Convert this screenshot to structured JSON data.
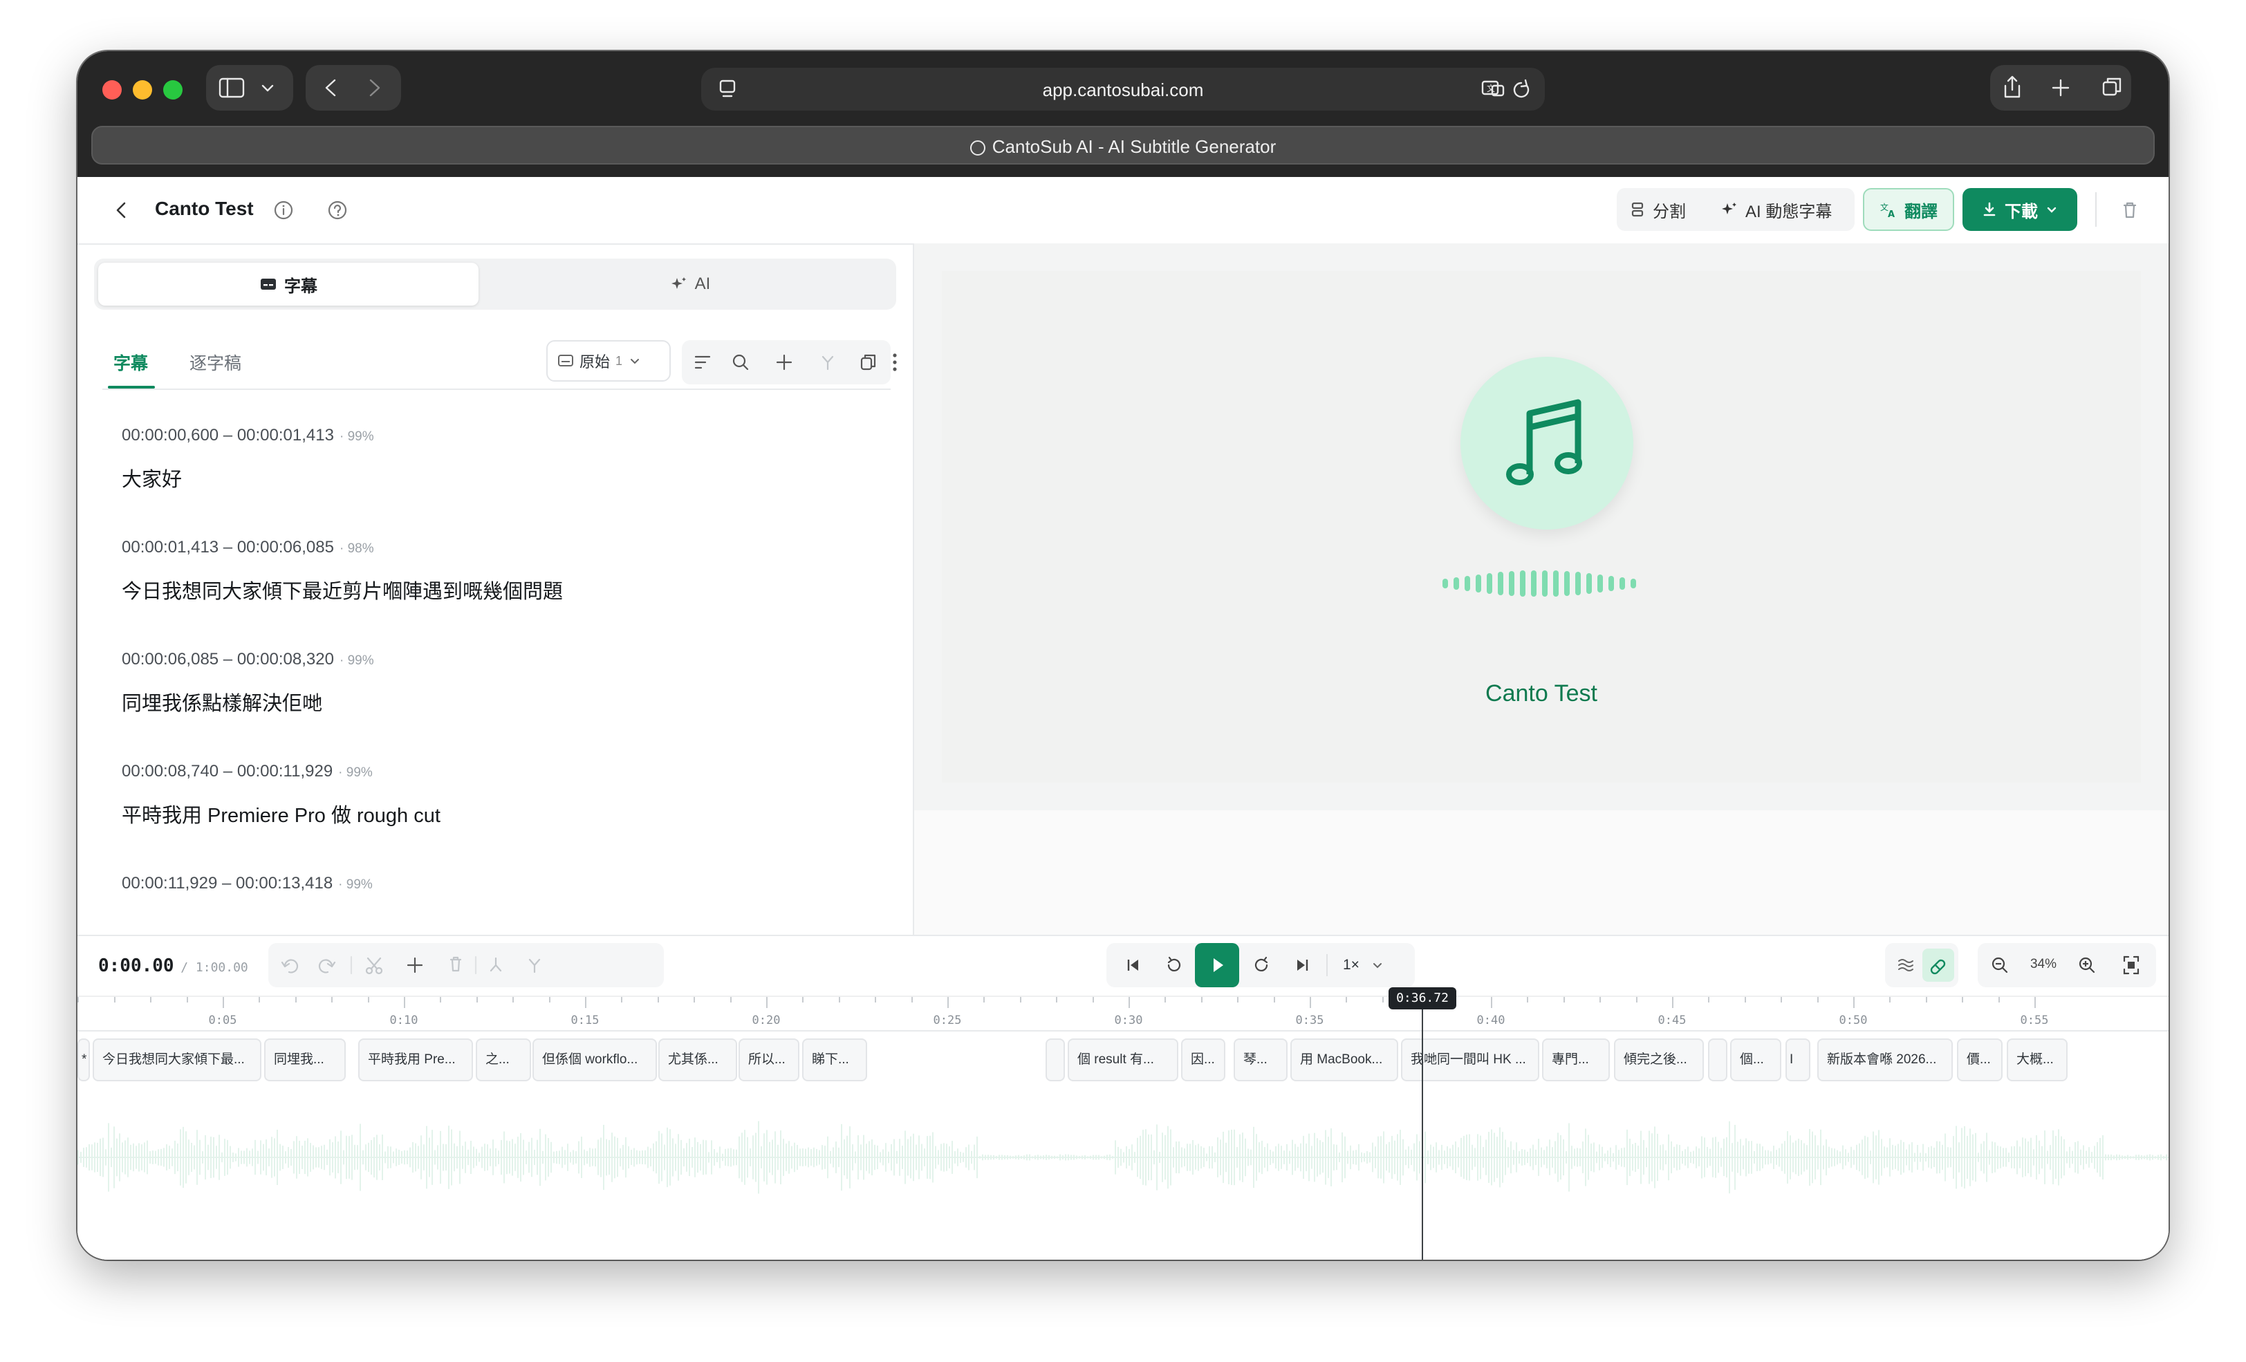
{
  "browser": {
    "url": "app.cantosubai.com",
    "tab_title": "CantoSub AI - AI Subtitle Generator"
  },
  "header": {
    "project_title": "Canto Test",
    "split_label": "分割",
    "ai_dynamic_label": "AI 動態字幕",
    "translate_label": "翻譯",
    "download_label": "下載"
  },
  "left": {
    "segment": {
      "subtitles": "字幕",
      "ai": "AI"
    },
    "subtabs": {
      "subtitles": "字幕",
      "transcript": "逐字稿"
    },
    "track_select": {
      "label": "原始",
      "count": "1"
    },
    "cues": [
      {
        "time": "00:00:00,600 – 00:00:01,413",
        "conf": "99%",
        "text": "大家好"
      },
      {
        "time": "00:00:01,413 – 00:00:06,085",
        "conf": "98%",
        "text": "今日我想同大家傾下最近剪片嗰陣遇到嘅幾個問題"
      },
      {
        "time": "00:00:06,085 – 00:00:08,320",
        "conf": "99%",
        "text": "同埋我係點樣解決佢哋"
      },
      {
        "time": "00:00:08,740 – 00:00:11,929",
        "conf": "99%",
        "text": "平時我用 Premiere Pro 做 rough cut"
      },
      {
        "time": "00:00:11,929 – 00:00:13,418",
        "conf": "99%",
        "text": ""
      }
    ]
  },
  "preview": {
    "title": "Canto Test"
  },
  "timeline": {
    "current_time": "0:00.00",
    "duration": "1:00.00",
    "speed": "1×",
    "zoom": "34%",
    "playhead_label": "0:36.72",
    "ticks": [
      "0:05",
      "0:10",
      "0:15",
      "0:20",
      "0:25",
      "0:30",
      "0:35",
      "0:40",
      "0:45",
      "0:50",
      "0:55"
    ],
    "clips": [
      {
        "text": "*"
      },
      {
        "text": "今日我想同大家傾下最..."
      },
      {
        "text": "同埋我..."
      },
      {
        "text": "平時我用 Pre..."
      },
      {
        "text": "之..."
      },
      {
        "text": "但係個 workflo..."
      },
      {
        "text": "尤其係..."
      },
      {
        "text": "所以..."
      },
      {
        "text": "睇下..."
      },
      {
        "text": ""
      },
      {
        "text": "個 result 有..."
      },
      {
        "text": "因..."
      },
      {
        "text": "琴..."
      },
      {
        "text": "用 MacBook..."
      },
      {
        "text": "我哋同一間叫 HK ..."
      },
      {
        "text": "專門..."
      },
      {
        "text": "傾完之後..."
      },
      {
        "text": ""
      },
      {
        "text": "個..."
      },
      {
        "text": "I"
      },
      {
        "text": "新版本會喺 2026..."
      },
      {
        "text": "價..."
      },
      {
        "text": "大概..."
      }
    ]
  },
  "colors": {
    "accent": "#0f8a5f",
    "accent_light": "#d1f3e2"
  }
}
